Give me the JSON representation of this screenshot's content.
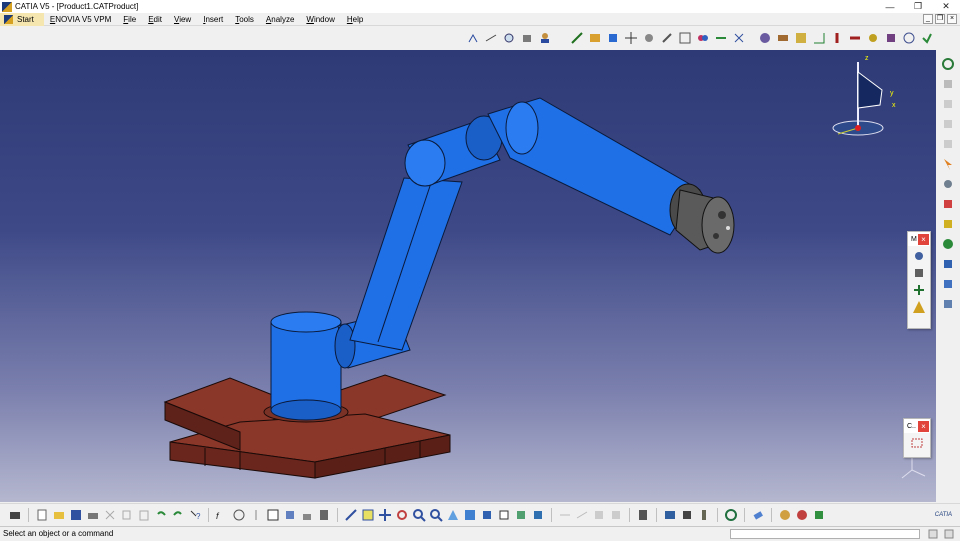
{
  "window": {
    "title": "CATIA V5 - [Product1.CATProduct]",
    "controls": {
      "minimize": "—",
      "restore": "❐",
      "close": "✕"
    }
  },
  "menubar": {
    "items": [
      "Start",
      "ENOVIA V5 VPM",
      "File",
      "Edit",
      "View",
      "Insert",
      "Tools",
      "Analyze",
      "Window",
      "Help"
    ]
  },
  "mdi": {
    "minimize": "_",
    "restore": "❐",
    "close": "×"
  },
  "compass": {
    "x_label": "x",
    "y_label": "y",
    "z_label": "z"
  },
  "panels": {
    "panel1_title": "M",
    "panel2_title": "C..",
    "close_glyph": "×"
  },
  "statusbar": {
    "message": "Select an object or a command",
    "input_value": ""
  },
  "logo": {
    "text": "CATIA"
  },
  "colors": {
    "robot_blue": "#1f6fe6",
    "base_brown": "#7a2e24",
    "bg_top": "#2e3a75",
    "bg_bottom": "#b5b7cf"
  }
}
